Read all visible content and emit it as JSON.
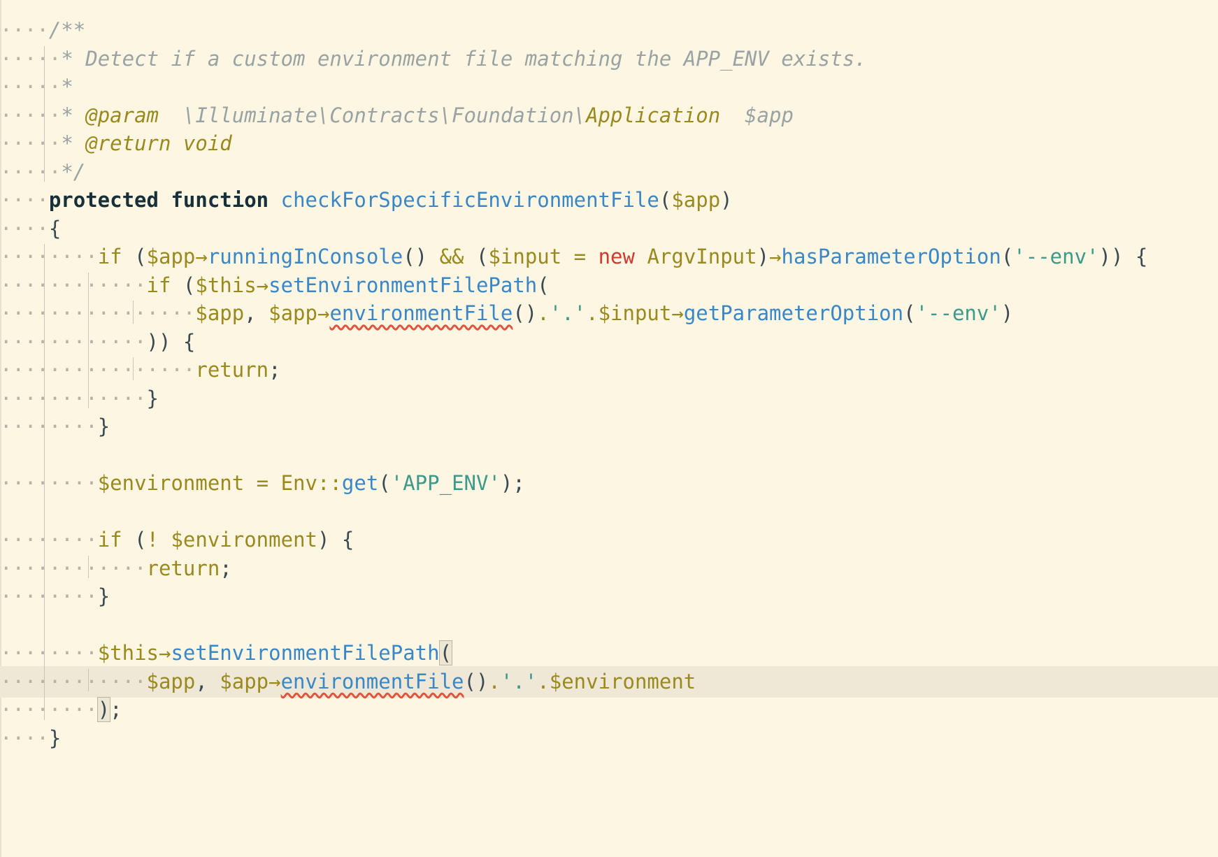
{
  "editor": {
    "language": "php",
    "current_line_index": 23,
    "lines": [
      {
        "indent": 4,
        "tokens": [
          {
            "t": "/**",
            "c": "cm"
          }
        ]
      },
      {
        "indent": 5,
        "tokens": [
          {
            "t": "* Detect if a custom environment file matching the APP_ENV exists.",
            "c": "cm"
          }
        ]
      },
      {
        "indent": 5,
        "tokens": [
          {
            "t": "*",
            "c": "cm"
          }
        ]
      },
      {
        "indent": 5,
        "tokens": [
          {
            "t": "* ",
            "c": "cm"
          },
          {
            "t": "@param",
            "c": "tag"
          },
          {
            "t": "  \\Illuminate\\Contracts\\Foundation\\",
            "c": "cm"
          },
          {
            "t": "Application",
            "c": "tag"
          },
          {
            "t": "  $app",
            "c": "cm"
          }
        ]
      },
      {
        "indent": 5,
        "tokens": [
          {
            "t": "* ",
            "c": "cm"
          },
          {
            "t": "@return",
            "c": "tag"
          },
          {
            "t": " ",
            "c": "cm"
          },
          {
            "t": "void",
            "c": "tag"
          }
        ]
      },
      {
        "indent": 5,
        "tokens": [
          {
            "t": "*/",
            "c": "cm"
          }
        ]
      },
      {
        "indent": 4,
        "tokens": [
          {
            "t": "protected",
            "c": "kw"
          },
          {
            "t": " ",
            "c": "p"
          },
          {
            "t": "function",
            "c": "kw"
          },
          {
            "t": " ",
            "c": "p"
          },
          {
            "t": "checkForSpecificEnvironmentFile",
            "c": "fn"
          },
          {
            "t": "(",
            "c": "p"
          },
          {
            "t": "$app",
            "c": "var"
          },
          {
            "t": ")",
            "c": "p"
          }
        ]
      },
      {
        "indent": 4,
        "tokens": [
          {
            "t": "{",
            "c": "p"
          }
        ]
      },
      {
        "indent": 8,
        "tokens": [
          {
            "t": "if",
            "c": "kw2"
          },
          {
            "t": " (",
            "c": "p"
          },
          {
            "t": "$app",
            "c": "var"
          },
          {
            "t": "→",
            "c": "var"
          },
          {
            "t": "runningInConsole",
            "c": "fn"
          },
          {
            "t": "() ",
            "c": "p"
          },
          {
            "t": "&&",
            "c": "var"
          },
          {
            "t": " (",
            "c": "p"
          },
          {
            "t": "$input",
            "c": "var"
          },
          {
            "t": " = ",
            "c": "var"
          },
          {
            "t": "new",
            "c": "new"
          },
          {
            "t": " ",
            "c": "p"
          },
          {
            "t": "ArgvInput",
            "c": "var"
          },
          {
            "t": ")",
            "c": "p"
          },
          {
            "t": "→",
            "c": "var"
          },
          {
            "t": "hasParameterOption",
            "c": "fn"
          },
          {
            "t": "(",
            "c": "p"
          },
          {
            "t": "'--env'",
            "c": "str"
          },
          {
            "t": ")) {",
            "c": "p"
          }
        ]
      },
      {
        "indent": 12,
        "tokens": [
          {
            "t": "if",
            "c": "kw2"
          },
          {
            "t": " (",
            "c": "p"
          },
          {
            "t": "$this",
            "c": "var"
          },
          {
            "t": "→",
            "c": "var"
          },
          {
            "t": "setEnvironmentFilePath",
            "c": "fn"
          },
          {
            "t": "(",
            "c": "p"
          }
        ]
      },
      {
        "indent": 16,
        "tokens": [
          {
            "t": "$app",
            "c": "var"
          },
          {
            "t": ", ",
            "c": "p"
          },
          {
            "t": "$app",
            "c": "var"
          },
          {
            "t": "→",
            "c": "var"
          },
          {
            "t": "environmentFile",
            "c": "err"
          },
          {
            "t": "()",
            "c": "p"
          },
          {
            "t": ".",
            "c": "var"
          },
          {
            "t": "'.'",
            "c": "str"
          },
          {
            "t": ".",
            "c": "var"
          },
          {
            "t": "$input",
            "c": "var"
          },
          {
            "t": "→",
            "c": "var"
          },
          {
            "t": "getParameterOption",
            "c": "fn"
          },
          {
            "t": "(",
            "c": "p"
          },
          {
            "t": "'--env'",
            "c": "str"
          },
          {
            "t": ")",
            "c": "p"
          }
        ]
      },
      {
        "indent": 12,
        "tokens": [
          {
            "t": ")) {",
            "c": "p"
          }
        ]
      },
      {
        "indent": 16,
        "tokens": [
          {
            "t": "return",
            "c": "kw2"
          },
          {
            "t": ";",
            "c": "p"
          }
        ]
      },
      {
        "indent": 12,
        "tokens": [
          {
            "t": "}",
            "c": "p"
          }
        ]
      },
      {
        "indent": 8,
        "tokens": [
          {
            "t": "}",
            "c": "p"
          }
        ]
      },
      {
        "indent": 0,
        "tokens": []
      },
      {
        "indent": 8,
        "tokens": [
          {
            "t": "$environment",
            "c": "var"
          },
          {
            "t": " = ",
            "c": "var"
          },
          {
            "t": "Env",
            "c": "var"
          },
          {
            "t": "::",
            "c": "var"
          },
          {
            "t": "get",
            "c": "fn"
          },
          {
            "t": "(",
            "c": "p"
          },
          {
            "t": "'APP_ENV'",
            "c": "str"
          },
          {
            "t": ");",
            "c": "p"
          }
        ]
      },
      {
        "indent": 0,
        "tokens": []
      },
      {
        "indent": 8,
        "tokens": [
          {
            "t": "if",
            "c": "kw2"
          },
          {
            "t": " (",
            "c": "p"
          },
          {
            "t": "!",
            "c": "var"
          },
          {
            "t": " ",
            "c": "p"
          },
          {
            "t": "$environment",
            "c": "var"
          },
          {
            "t": ") {",
            "c": "p"
          }
        ]
      },
      {
        "indent": 12,
        "tokens": [
          {
            "t": "return",
            "c": "kw2"
          },
          {
            "t": ";",
            "c": "p"
          }
        ]
      },
      {
        "indent": 8,
        "tokens": [
          {
            "t": "}",
            "c": "p"
          }
        ]
      },
      {
        "indent": 0,
        "tokens": []
      },
      {
        "indent": 8,
        "tokens": [
          {
            "t": "$this",
            "c": "var"
          },
          {
            "t": "→",
            "c": "var"
          },
          {
            "t": "setEnvironmentFilePath",
            "c": "fn"
          },
          {
            "t": "(",
            "c": "hl"
          }
        ]
      },
      {
        "indent": 12,
        "tokens": [
          {
            "t": "$app",
            "c": "var"
          },
          {
            "t": ", ",
            "c": "p"
          },
          {
            "t": "$app",
            "c": "var"
          },
          {
            "t": "→",
            "c": "var"
          },
          {
            "t": "environmentFile",
            "c": "err"
          },
          {
            "t": "()",
            "c": "p"
          },
          {
            "t": ".",
            "c": "var"
          },
          {
            "t": "'.'",
            "c": "str"
          },
          {
            "t": ".",
            "c": "var"
          },
          {
            "t": "$environment",
            "c": "var"
          }
        ]
      },
      {
        "indent": 8,
        "tokens": [
          {
            "t": ")",
            "c": "hl"
          },
          {
            "t": ";",
            "c": "p"
          }
        ]
      },
      {
        "indent": 4,
        "tokens": [
          {
            "t": "}",
            "c": "p"
          }
        ]
      }
    ]
  }
}
